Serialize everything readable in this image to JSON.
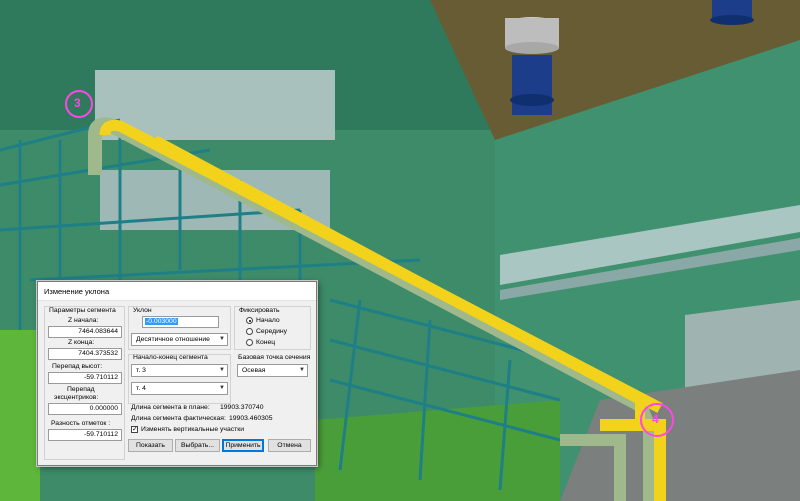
{
  "scene": {
    "markers": [
      "3",
      "4"
    ],
    "colors": {
      "wall": "#3b8a68",
      "roof": "#675c34",
      "pipe_yellow": "#f2d21a",
      "pipe_green": "#9fb98c",
      "steel": "#1e7f86",
      "marker": "#ff46e6"
    }
  },
  "dialog": {
    "title": "Изменение уклона",
    "segment_params": {
      "label": "Параметры сегмента",
      "z_start_label": "Z начала:",
      "z_start": "7464.083644",
      "z_end_label": "Z конца:",
      "z_end": "7404.373532",
      "height_drop_label": "Перепад высот:",
      "height_drop": "-59.710112",
      "ecc_drop_label_1": "Перепад",
      "ecc_drop_label_2": "эксцентриков:",
      "ecc_drop": "0.000000",
      "elev_diff_label": "Разность отметок :",
      "elev_diff": "-59.710112"
    },
    "slope": {
      "label": "Уклон",
      "value": "-0.003000",
      "unit": "Десятичное отношение"
    },
    "fix": {
      "label": "Фиксировать",
      "options": [
        "Начало",
        "Середину",
        "Конец"
      ],
      "selected": "Начало"
    },
    "segment_range": {
      "label": "Начало-конец сегмента",
      "start": "т. 3",
      "end": "т. 4"
    },
    "base_point": {
      "label": "Базовая точка сечения",
      "value": "Осевая"
    },
    "plan_length_label": "Длина сегмента в плане:",
    "plan_length": "19903.370740",
    "actual_length_label": "Длина сегмента фактическая:",
    "actual_length": "19903.460305",
    "vertical_check_label": "Изменять вертикальные участки",
    "vertical_check": true,
    "buttons": {
      "show": "Показать",
      "pick": "Выбрать...",
      "apply": "Применить",
      "cancel": "Отмена"
    }
  }
}
